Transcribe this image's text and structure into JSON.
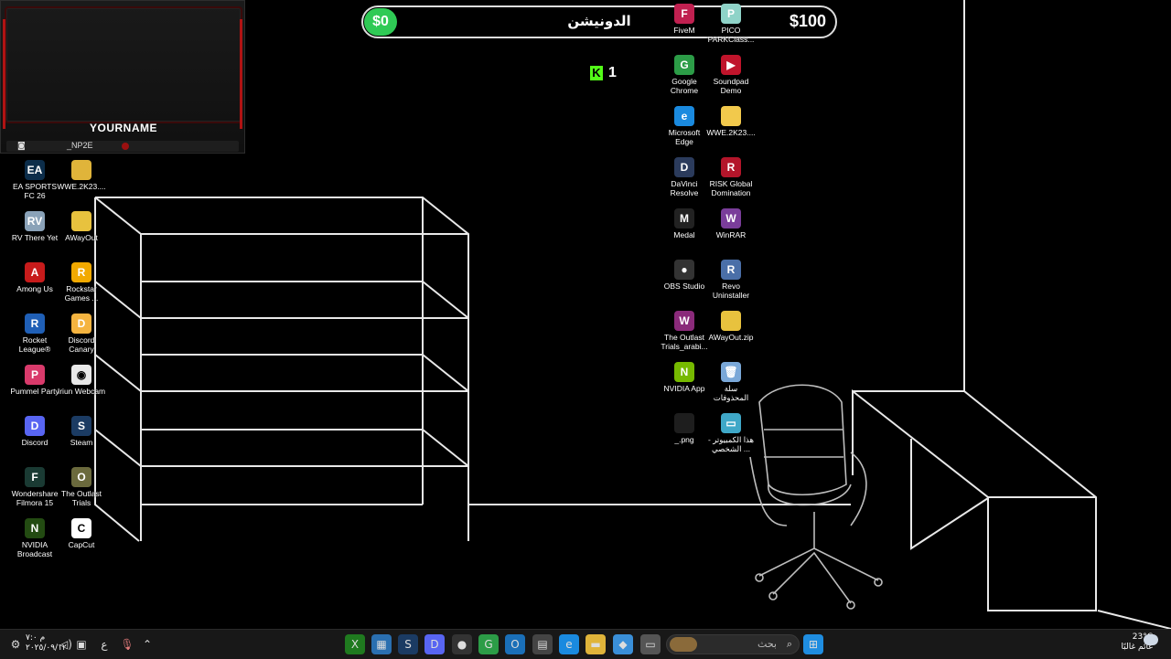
{
  "overlay": {
    "name": "YOURNAME",
    "handle": "_NP2E"
  },
  "donation": {
    "current": "$0",
    "title": "الدونيشن",
    "goal": "$100"
  },
  "kick": {
    "count": "1"
  },
  "icons_left": [
    {
      "label": "EA SPORTS FC 26",
      "color": "#0c2d4a",
      "glyph": "EA"
    },
    {
      "label": "WWE.2K23....",
      "color": "#e0b43a",
      "glyph": ""
    },
    {
      "label": "RV There Yet",
      "color": "#8aa2b8",
      "glyph": "RV"
    },
    {
      "label": "AWayOut",
      "color": "#e8c23e",
      "glyph": ""
    },
    {
      "label": "Among Us",
      "color": "#c71b1b",
      "glyph": "A"
    },
    {
      "label": "Rockstar Games ...",
      "color": "#f2a900",
      "glyph": "R"
    },
    {
      "label": "Rocket League®",
      "color": "#1f5fb6",
      "glyph": "R"
    },
    {
      "label": "Discord Canary",
      "color": "#f5b440",
      "glyph": "D"
    },
    {
      "label": "Pummel Party",
      "color": "#d93a6b",
      "glyph": "P"
    },
    {
      "label": "Iriun Webcam",
      "color": "#e8e8e8",
      "glyph": "◉"
    },
    {
      "label": "Discord",
      "color": "#5865f2",
      "glyph": "D"
    },
    {
      "label": "Steam",
      "color": "#1b3b63",
      "glyph": "S"
    },
    {
      "label": "Wondershare Filmora 15",
      "color": "#1a3a33",
      "glyph": "F"
    },
    {
      "label": "The Outlast Trials",
      "color": "#6b6a3d",
      "glyph": "O"
    },
    {
      "label": "NVIDIA Broadcast",
      "color": "#234b12",
      "glyph": "N"
    },
    {
      "label": "CapCut",
      "color": "#ffffff",
      "glyph": "C"
    }
  ],
  "icons_right": [
    {
      "label": "FiveM",
      "color": "#c02050",
      "glyph": "F"
    },
    {
      "label": "PICO PARKClass...",
      "color": "#8fd3c8",
      "glyph": "P"
    },
    {
      "label": "Google Chrome",
      "color": "#2c9c47",
      "glyph": "G"
    },
    {
      "label": "Soundpad Demo",
      "color": "#c0142b",
      "glyph": "▶"
    },
    {
      "label": "Microsoft Edge",
      "color": "#1a8adf",
      "glyph": "e"
    },
    {
      "label": "WWE.2K23....",
      "color": "#f2c94c",
      "glyph": ""
    },
    {
      "label": "DaVinci Resolve",
      "color": "#2b3b5c",
      "glyph": "D"
    },
    {
      "label": "RISK Global Domination",
      "color": "#b3152a",
      "glyph": "R"
    },
    {
      "label": "Medal",
      "color": "#222222",
      "glyph": "M"
    },
    {
      "label": "WinRAR",
      "color": "#7a3d9a",
      "glyph": "W"
    },
    {
      "label": "OBS Studio",
      "color": "#333333",
      "glyph": "●"
    },
    {
      "label": "Revo Uninstaller",
      "color": "#4a6fa8",
      "glyph": "R"
    },
    {
      "label": "The Outlast Trials_arabi...",
      "color": "#8a2a7a",
      "glyph": "W"
    },
    {
      "label": "AWayOut.zip",
      "color": "#e8c23e",
      "glyph": ""
    },
    {
      "label": "NVIDIA App",
      "color": "#76b900",
      "glyph": "N"
    },
    {
      "label": "سلة المحذوفات",
      "color": "#7aa8d8",
      "glyph": "🗑"
    },
    {
      "label": "_.png",
      "color": "#1e1e1e",
      "glyph": ""
    },
    {
      "label": "هذا الكمبيوتر - الشخصي ...",
      "color": "#3fa8c8",
      "glyph": "▭"
    }
  ],
  "taskbar": {
    "search_placeholder": "بحث",
    "weather_temp": "23°C",
    "weather_desc": "غائم غالبًا",
    "clock_time": "م ۷:۰",
    "clock_date": "٢٠٢٥/٠٩/١٢",
    "lang": "ع"
  }
}
